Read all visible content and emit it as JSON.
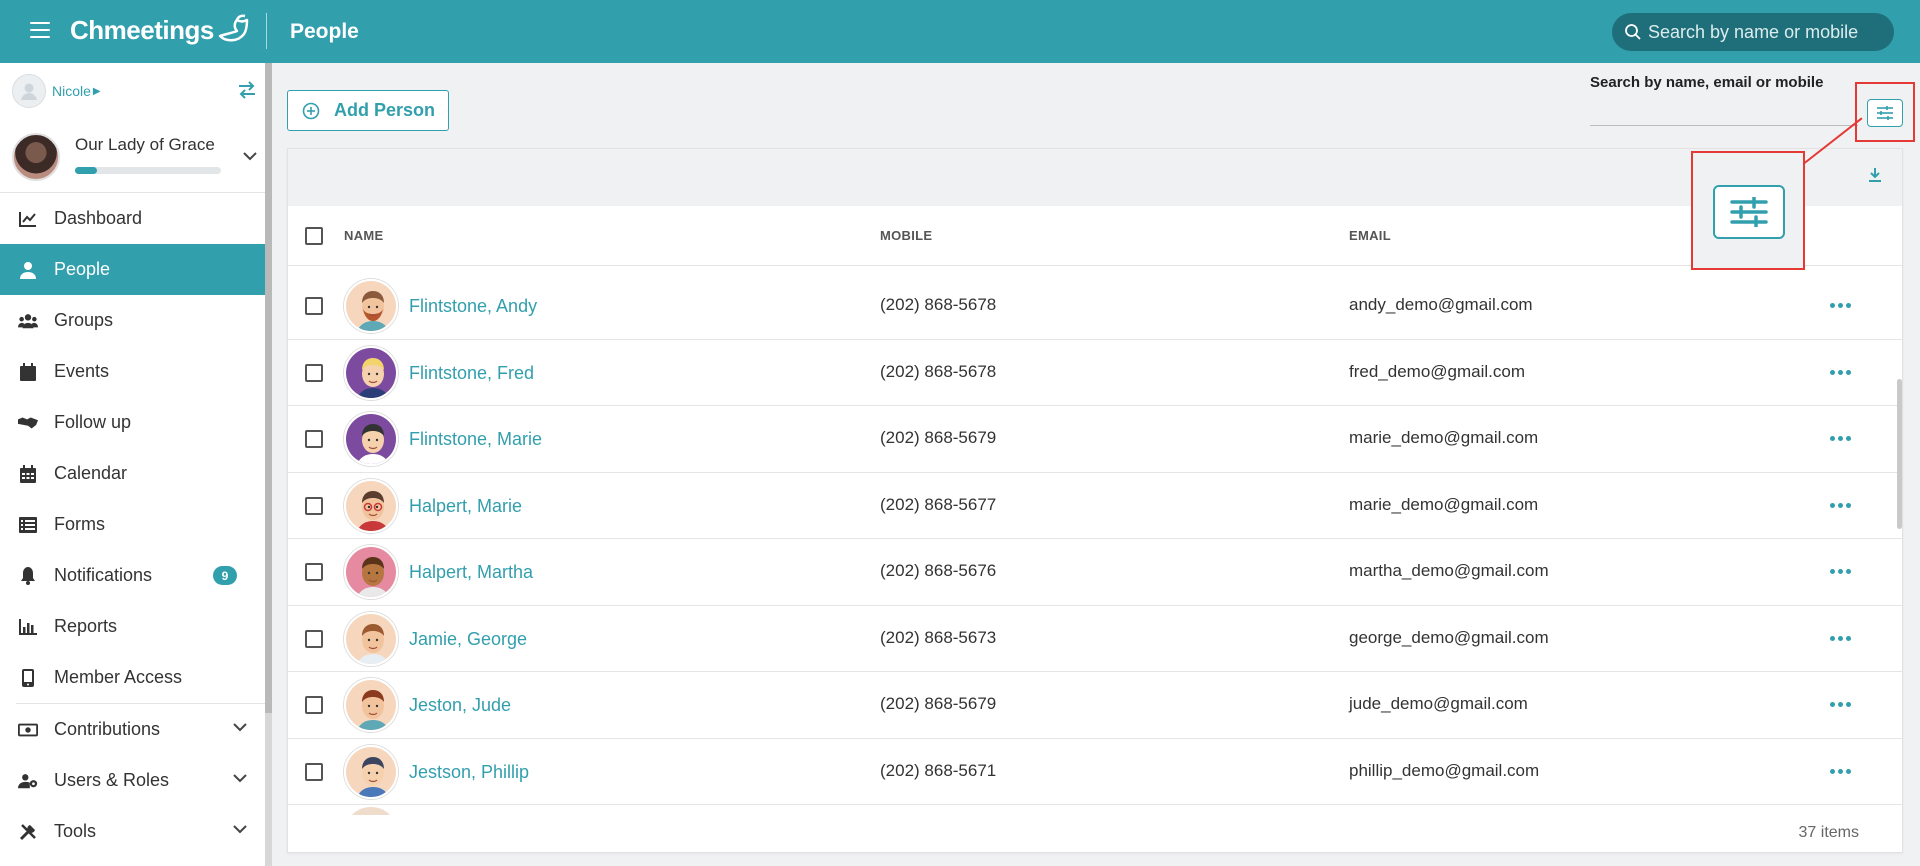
{
  "header": {
    "app_name": "Chmeetings",
    "page_title": "People",
    "search_placeholder": "Search by name or mobile"
  },
  "sidebar": {
    "user_name": "Nicole",
    "church_name": "Our Lady of Grace",
    "church_progress": 0.15,
    "items": [
      {
        "label": "Dashboard",
        "icon": "chart-line-icon"
      },
      {
        "label": "People",
        "icon": "person-icon",
        "active": true
      },
      {
        "label": "Groups",
        "icon": "users-icon"
      },
      {
        "label": "Events",
        "icon": "calendar-icon"
      },
      {
        "label": "Follow up",
        "icon": "handshake-icon"
      },
      {
        "label": "Calendar",
        "icon": "calendar-grid-icon"
      },
      {
        "label": "Forms",
        "icon": "list-icon"
      },
      {
        "label": "Notifications",
        "icon": "bell-icon",
        "badge": "9"
      },
      {
        "label": "Reports",
        "icon": "bar-chart-icon"
      },
      {
        "label": "Member Access",
        "icon": "mobile-icon"
      },
      {
        "label": "Contributions",
        "icon": "money-icon",
        "expandable": true
      },
      {
        "label": "Users & Roles",
        "icon": "users-cog-icon",
        "expandable": true
      },
      {
        "label": "Tools",
        "icon": "tools-icon",
        "expandable": true
      }
    ]
  },
  "toolbar": {
    "add_person_label": "Add Person",
    "search_label": "Search by name, email or mobile"
  },
  "table": {
    "columns": [
      "NAME",
      "MOBILE",
      "EMAIL"
    ],
    "rows": [
      {
        "name": "Flintstone, Andy",
        "mobile": "(202) 868-5678",
        "email": "andy_demo@gmail.com"
      },
      {
        "name": "Flintstone, Fred",
        "mobile": "(202) 868-5678",
        "email": "fred_demo@gmail.com"
      },
      {
        "name": "Flintstone, Marie",
        "mobile": "(202) 868-5679",
        "email": "marie_demo@gmail.com"
      },
      {
        "name": "Halpert, Marie",
        "mobile": "(202) 868-5677",
        "email": "marie_demo@gmail.com"
      },
      {
        "name": "Halpert, Martha",
        "mobile": "(202) 868-5676",
        "email": "martha_demo@gmail.com"
      },
      {
        "name": "Jamie, George",
        "mobile": "(202) 868-5673",
        "email": "george_demo@gmail.com"
      },
      {
        "name": "Jeston, Jude",
        "mobile": "(202) 868-5679",
        "email": "jude_demo@gmail.com"
      },
      {
        "name": "Jestson, Phillip",
        "mobile": "(202) 868-5671",
        "email": "phillip_demo@gmail.com"
      }
    ],
    "items_count": "37 items"
  },
  "colors": {
    "brand": "#329fad",
    "highlight": "#e53935"
  }
}
